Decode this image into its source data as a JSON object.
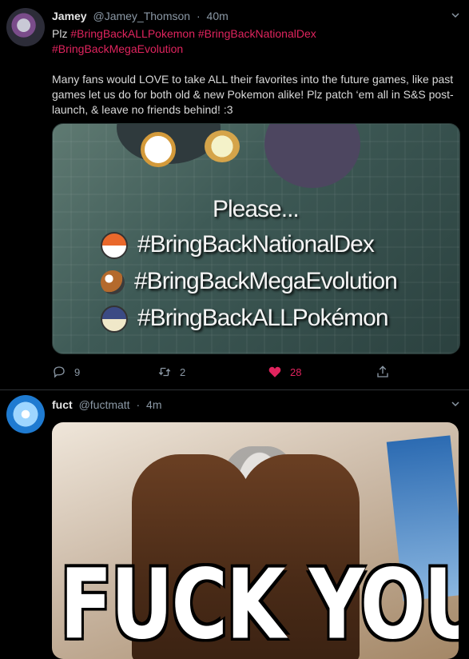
{
  "tweets": [
    {
      "display_name": "Jamey",
      "handle": "@Jamey_Thomson",
      "separator": "·",
      "time": "40m",
      "text_line1_prefix": "Plz ",
      "hashtags": [
        "#BringBackALLPokemon",
        "#BringBackNationalDex",
        "#BringBackMegaEvolution"
      ],
      "body": "Many fans would LOVE to take ALL their favorites into the future games, like past games let us do for both old & new Pokemon alike! Plz patch ‘em all in S&S post-launch, & leave no friends behind! :3",
      "image": {
        "please": "Please...",
        "lines": [
          "#BringBackNationalDex",
          "#BringBackMegaEvolution",
          "#BringBackALLPokémon"
        ]
      },
      "actions": {
        "reply_count": "9",
        "retweet_count": "2",
        "like_count": "28"
      }
    },
    {
      "display_name": "fuct",
      "handle": "@fuctmatt",
      "separator": "·",
      "time": "4m",
      "image": {
        "caption": "FUCK YOU"
      }
    }
  ],
  "colors": {
    "background": "#000000",
    "hashtag": "#e0245e",
    "secondary_text": "#8b98a5",
    "like_active": "#e0245e"
  },
  "icons": [
    "reply-icon",
    "retweet-icon",
    "heart-icon",
    "share-icon",
    "chevron-down-icon"
  ]
}
